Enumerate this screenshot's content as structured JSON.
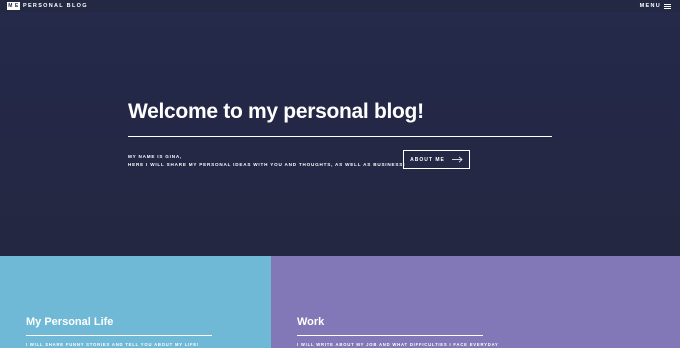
{
  "header": {
    "logo_mark": "M E",
    "logo_text": "PERSONAL BLOG",
    "menu_label": "MENU"
  },
  "hero": {
    "title": "Welcome to my personal blog!",
    "intro_line1": "MY NAME IS GINA,",
    "intro_line2": "HERE I WILL SHARE MY PERSONAL IDEAS WITH YOU AND THOUGHTS, AS WELL AS BUSINESS!",
    "about_button": "ABOUT ME"
  },
  "tiles": [
    {
      "title": "My Personal Life",
      "description": "I WILL SHARE FUNNY STORIES AND TELL YOU ABOUT MY LIFE!",
      "color": "#6fb9d6"
    },
    {
      "title": "Work",
      "description": "I WILL WRITE ABOUT MY JOB AND WHAT DIFFICULTIES I FACE EVERYDAY",
      "color": "#8278b8"
    }
  ],
  "colors": {
    "background": "#242943",
    "accent_text": "#ffffff"
  },
  "icons": {
    "menu": "hamburger-icon",
    "about": "arrow-right-icon"
  }
}
